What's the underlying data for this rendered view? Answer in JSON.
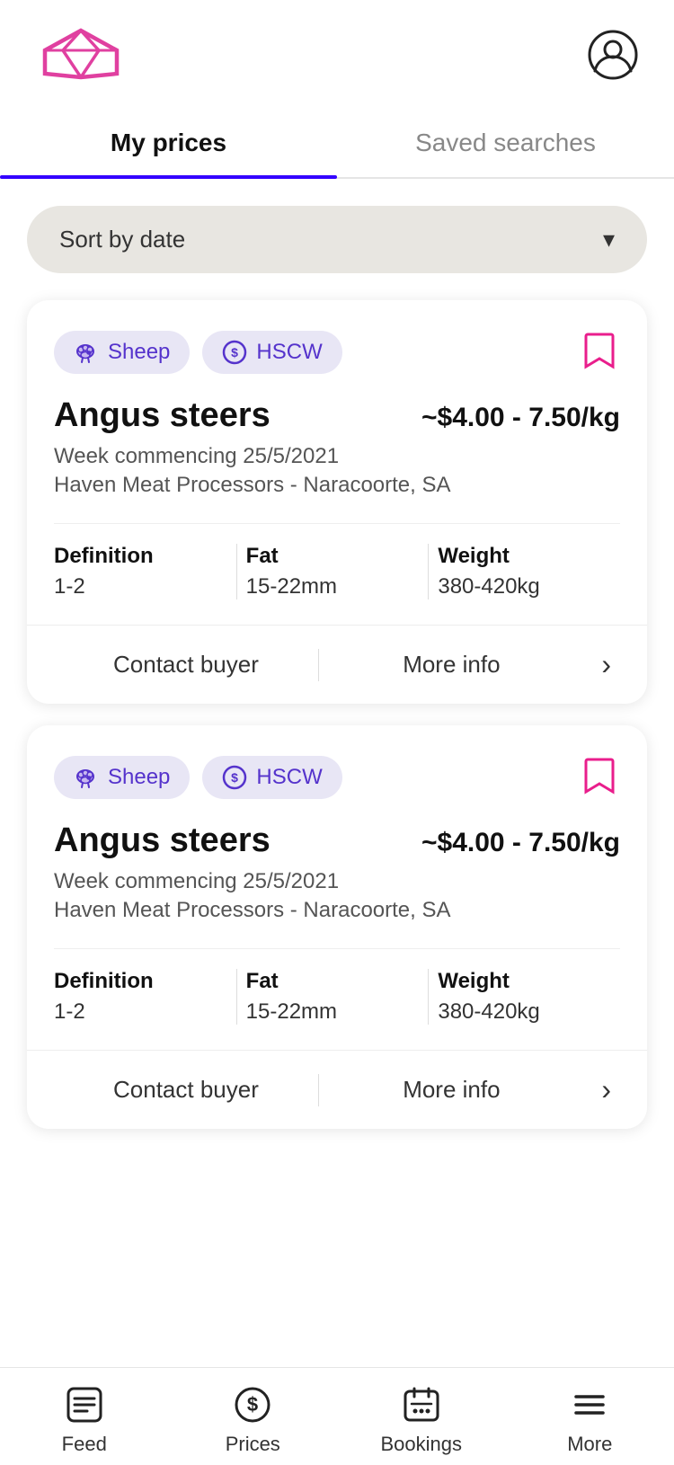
{
  "header": {
    "logo_alt": "App logo"
  },
  "tabs": {
    "active": "my-prices",
    "items": [
      {
        "id": "my-prices",
        "label": "My prices"
      },
      {
        "id": "saved-searches",
        "label": "Saved searches"
      }
    ]
  },
  "sort": {
    "label": "Sort by date",
    "chevron": "▾"
  },
  "cards": [
    {
      "id": "card-1",
      "tags": [
        {
          "id": "sheep",
          "label": "Sheep"
        },
        {
          "id": "hscw",
          "label": "HSCW"
        }
      ],
      "title": "Angus steers",
      "price": "~$4.00 - 7.50/kg",
      "week": "Week commencing 25/5/2021",
      "location": "Haven Meat Processors - Naracoorte, SA",
      "definition_label": "Definition",
      "definition_value": "1-2",
      "fat_label": "Fat",
      "fat_value": "15-22mm",
      "weight_label": "Weight",
      "weight_value": "380-420kg",
      "contact_buyer": "Contact buyer",
      "more_info": "More info"
    },
    {
      "id": "card-2",
      "tags": [
        {
          "id": "sheep",
          "label": "Sheep"
        },
        {
          "id": "hscw",
          "label": "HSCW"
        }
      ],
      "title": "Angus steers",
      "price": "~$4.00 - 7.50/kg",
      "week": "Week commencing 25/5/2021",
      "location": "Haven Meat Processors - Naracoorte, SA",
      "definition_label": "Definition",
      "definition_value": "1-2",
      "fat_label": "Fat",
      "fat_value": "15-22mm",
      "weight_label": "Weight",
      "weight_value": "380-420kg",
      "contact_buyer": "Contact buyer",
      "more_info": "More info"
    }
  ],
  "bottom_nav": {
    "items": [
      {
        "id": "feed",
        "label": "Feed"
      },
      {
        "id": "prices",
        "label": "Prices"
      },
      {
        "id": "bookings",
        "label": "Bookings"
      },
      {
        "id": "more",
        "label": "More"
      }
    ]
  }
}
